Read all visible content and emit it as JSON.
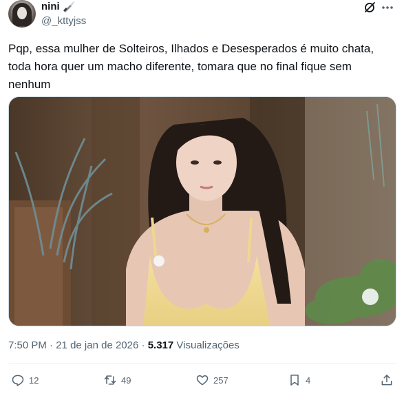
{
  "author": {
    "display_name": "nini",
    "handle": "@_kttyjss",
    "emoji_icon": "knife-icon"
  },
  "tweet": {
    "text": "Pqp, essa mulher de Solteiros, Ilhados e Desesperados é muito chata, toda hora quer um macho diferente, tomara que no final fique sem nenhum"
  },
  "meta": {
    "time": "7:50 PM",
    "dot1": "·",
    "date": "21 de jan de 2026",
    "dot2": "·",
    "views_count": "5.317",
    "views_label": "Visualizações"
  },
  "actions": {
    "replies": "12",
    "reposts": "49",
    "likes": "257",
    "bookmarks": "4"
  },
  "colors": {
    "text": "#0f1419",
    "secondary": "#536471",
    "border": "#cfd9de"
  }
}
